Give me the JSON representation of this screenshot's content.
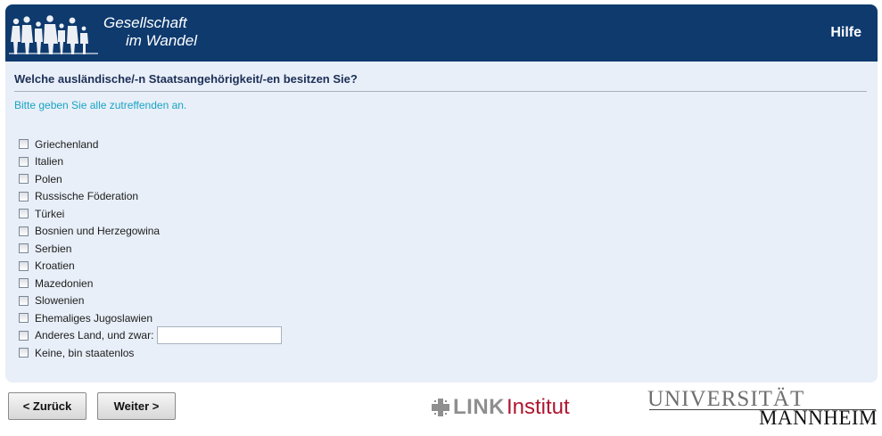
{
  "header": {
    "logo_line1": "Gesellschaft",
    "logo_line2": "im Wandel",
    "help_label": "Hilfe",
    "background": "#0e3a6e"
  },
  "question": {
    "title": "Welche ausländische/-n Staatsangehörigkeit/-en besitzen Sie?",
    "instruction": "Bitte geben Sie alle zutreffenden an."
  },
  "options": [
    {
      "label": "Griechenland",
      "checked": false
    },
    {
      "label": "Italien",
      "checked": false
    },
    {
      "label": "Polen",
      "checked": false
    },
    {
      "label": "Russische Föderation",
      "checked": false
    },
    {
      "label": "Türkei",
      "checked": false
    },
    {
      "label": "Bosnien und Herzegowina",
      "checked": false
    },
    {
      "label": "Serbien",
      "checked": false
    },
    {
      "label": "Kroatien",
      "checked": false
    },
    {
      "label": "Mazedonien",
      "checked": false
    },
    {
      "label": "Slowenien",
      "checked": false
    },
    {
      "label": "Ehemaliges Jugoslawien",
      "checked": false
    },
    {
      "label": "Anderes Land, und zwar:",
      "checked": false,
      "has_text_input": true,
      "input_value": ""
    },
    {
      "label": "Keine, bin staatenlos",
      "checked": false
    }
  ],
  "navigation": {
    "back_label": "< Zurück",
    "next_label": "Weiter >"
  },
  "logos": {
    "link_brand": "LINK",
    "link_sub": "Institut",
    "uni_line1": "UNIVERSITÄT",
    "uni_line2": "MANNHEIM"
  },
  "colors": {
    "panel_background": "#e8eff8",
    "question_text": "#1d2f57",
    "instruction_text": "#1aa3c4",
    "link_red": "#b0152f"
  }
}
